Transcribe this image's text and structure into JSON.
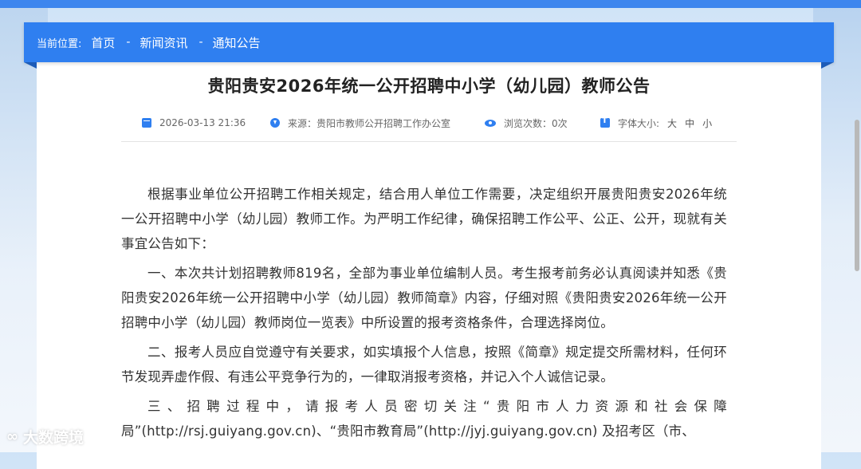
{
  "breadcrumb": {
    "label": "当前位置:",
    "items": [
      "首页",
      "新闻资讯",
      "通知公告"
    ],
    "separator": "-"
  },
  "article": {
    "title": "贵阳贵安2026年统一公开招聘中小学（幼儿园）教师公告",
    "meta": {
      "date": "2026-03-13 21:36",
      "source": "来源：贵阳市教师公开招聘工作办公室",
      "views": "浏览次数：0次",
      "font_size_label": "字体大小:",
      "font_sizes": [
        "大",
        "中",
        "小"
      ]
    },
    "paragraphs": [
      "根据事业单位公开招聘工作相关规定，结合用人单位工作需要，决定组织开展贵阳贵安2026年统一公开招聘中小学（幼儿园）教师工作。为严明工作纪律，确保招聘工作公平、公正、公开，现就有关事宜公告如下：",
      "一、本次共计划招聘教师819名，全部为事业单位编制人员。考生报考前务必认真阅读并知悉《贵阳贵安2026年统一公开招聘中小学（幼儿园）教师简章》内容，仔细对照《贵阳贵安2026年统一公开招聘中小学（幼儿园）教师岗位一览表》中所设置的报考资格条件，合理选择岗位。",
      "二、报考人员应自觉遵守有关要求，如实填报个人信息，按照《简章》规定提交所需材料，任何环节发现弄虚作假、有违公平竞争行为的，一律取消报考资格，并记入个人诚信记录。",
      "三、招聘过程中，请报考人员密切关注“贵阳市人力资源和社会保障局”(http://rsj.guiyang.gov.cn)、“贵阳市教育局”(http://jyj.guiyang.gov.cn) 及招考区（市、"
    ]
  },
  "watermark": {
    "text": "大数跨境"
  },
  "colors": {
    "accent": "#2f7ff0",
    "title": "#222222",
    "body_text": "#333333"
  }
}
